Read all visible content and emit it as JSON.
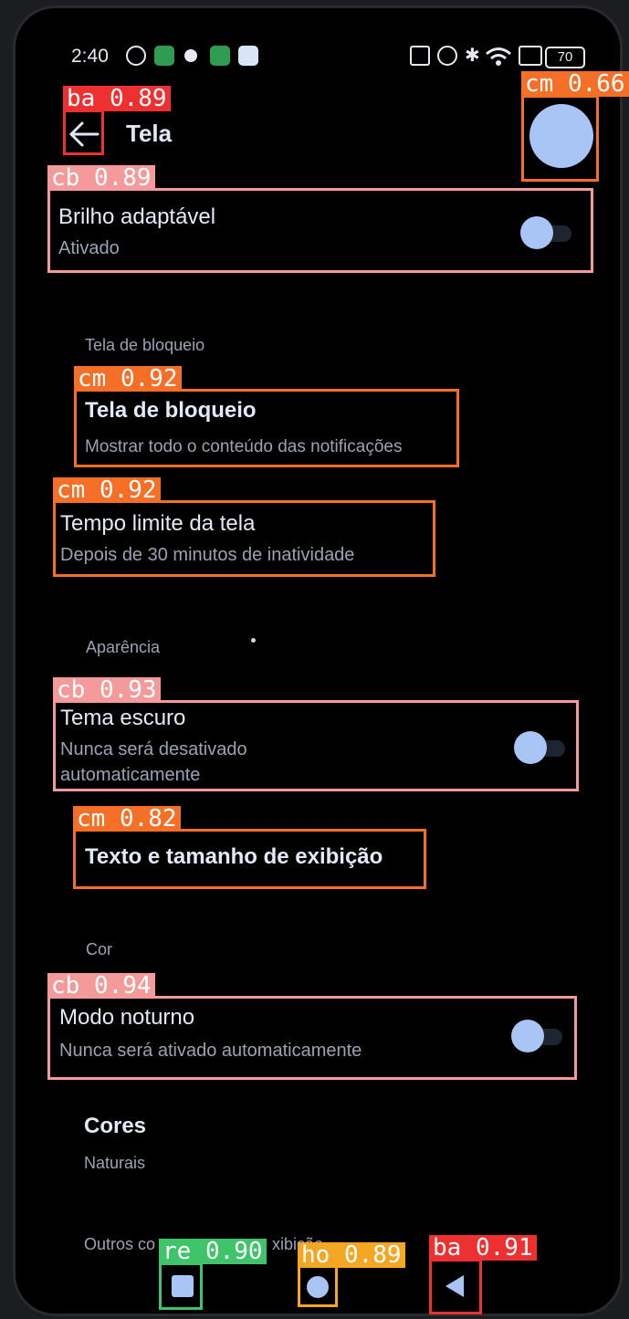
{
  "status_bar": {
    "time": "2:40",
    "battery": "70",
    "icons": [
      "chrome-icon",
      "app-grid-icon",
      "bug-icon",
      "app-icon",
      "gallery-icon",
      "nfc-icon",
      "alarm-icon",
      "bluetooth-icon",
      "wifi-icon",
      "close-box-icon"
    ]
  },
  "header": {
    "title": "Tela"
  },
  "rows": {
    "adaptive": {
      "title": "Brilho adaptável",
      "subtitle": "Ativado"
    },
    "section_lock": "Tela de bloqueio",
    "lockscreen": {
      "title": "Tela de bloqueio",
      "subtitle": "Mostrar todo o conteúdo das notificações"
    },
    "timeout": {
      "title": "Tempo limite da tela",
      "subtitle": "Depois de 30 minutos de inatividade"
    },
    "section_appearance": "Aparência",
    "dark": {
      "title": "Tema escuro",
      "subtitle1": "Nunca será desativado",
      "subtitle2": "automaticamente"
    },
    "text_size": {
      "title": "Texto e tamanho de exibição"
    },
    "section_color": "Cor",
    "night": {
      "title": "Modo noturno",
      "subtitle": "Nunca será ativado automaticamente"
    },
    "colors": {
      "title": "Cores",
      "subtitle": "Naturais"
    },
    "section_other": "Outros co",
    "section_other_tail": "xibição"
  },
  "overlay": {
    "ba_back": "ba 0.89",
    "cm_avatar": "cm 0.66",
    "cb_adaptive": "cb 0.89",
    "cm_lock": "cm 0.92",
    "cm_timeout": "cm 0.92",
    "cb_dark": "cb 0.93",
    "cm_text": "cm 0.82",
    "cb_night": "cb 0.94",
    "re_recent": "re 0.90",
    "ho_home": "ho 0.89",
    "ba_nav": "ba 0.91"
  },
  "colors": {
    "ba": "#ee3030",
    "cm": "#f56f26",
    "cb": "#f59a9a",
    "re": "#3fc46a",
    "ho": "#f5a623",
    "accent": "#a9c5f5"
  }
}
